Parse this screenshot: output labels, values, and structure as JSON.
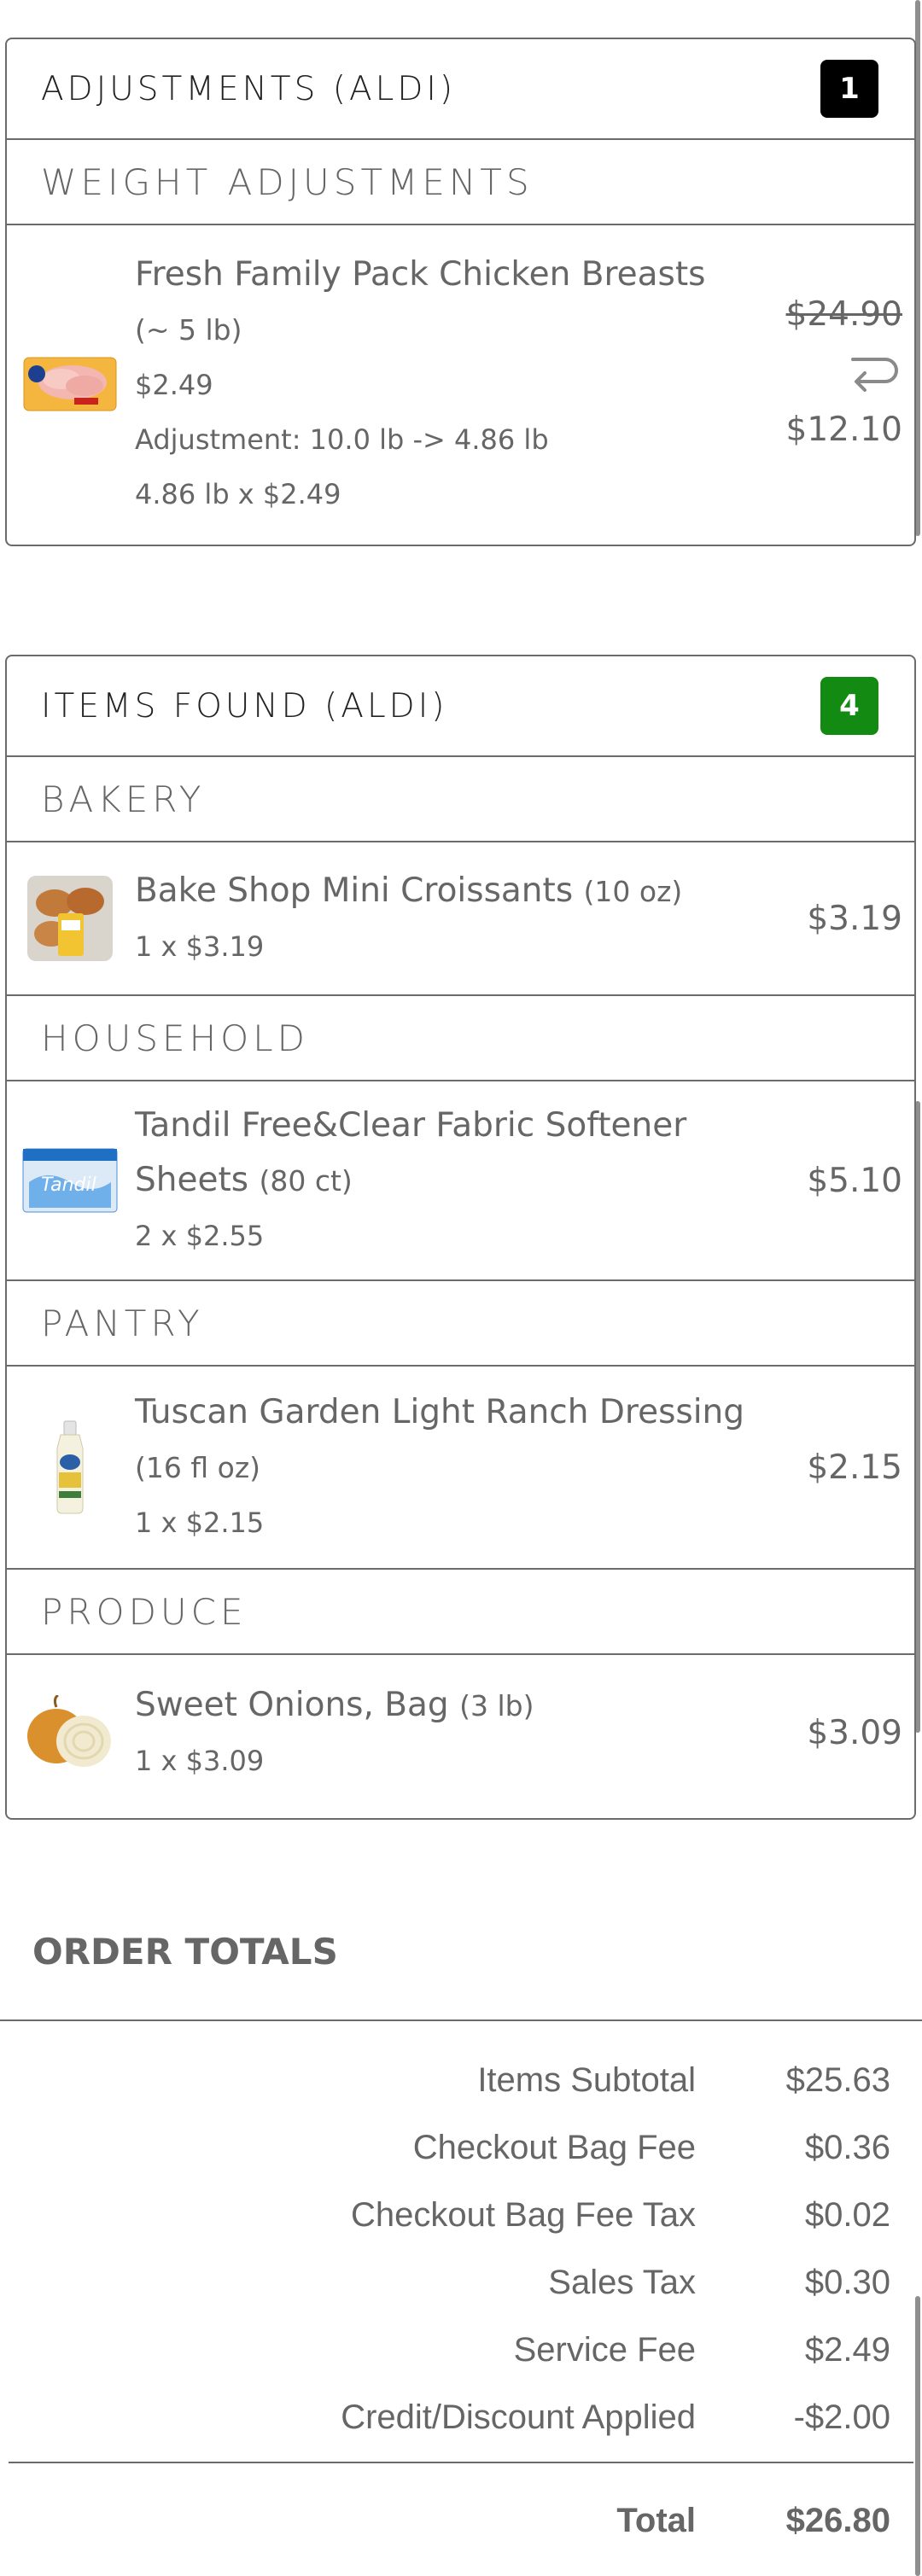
{
  "adjustments_card": {
    "title": "ADJUSTMENTS (ALDI)",
    "count": "1",
    "badge_color": "#000000",
    "section": "WEIGHT ADJUSTMENTS",
    "item": {
      "name": "Fresh Family Pack Chicken Breasts",
      "size": "(~ 5 lb)",
      "unit_price": "$2.49",
      "adjustment": "Adjustment: 10.0 lb -> 4.86 lb",
      "calc": "4.86 lb x $2.49",
      "old_price": "$24.90",
      "new_price": "$12.10",
      "icon": "return-arrow-icon"
    }
  },
  "found_card": {
    "title": "ITEMS FOUND (ALDI)",
    "count": "4",
    "badge_color": "#138a12",
    "sections": [
      {
        "name": "BAKERY",
        "item": {
          "name": "Bake Shop Mini Croissants",
          "size": "(10 oz)",
          "qty": "1 x $3.19",
          "price": "$3.19"
        }
      },
      {
        "name": "HOUSEHOLD",
        "item": {
          "name": "Tandil Free&Clear Fabric Softener Sheets",
          "size": "(80 ct)",
          "qty": "2 x $2.55",
          "price": "$5.10"
        }
      },
      {
        "name": "PANTRY",
        "item": {
          "name": "Tuscan Garden Light Ranch Dressing",
          "size": "(16 fl oz)",
          "qty": "1 x $2.15",
          "price": "$2.15"
        }
      },
      {
        "name": "PRODUCE",
        "item": {
          "name": "Sweet Onions, Bag",
          "size": "(3 lb)",
          "qty": "1 x $3.09",
          "price": "$3.09"
        }
      }
    ]
  },
  "order_totals": {
    "title": "ORDER TOTALS",
    "rows": [
      {
        "label": "Items Subtotal",
        "value": "$25.63"
      },
      {
        "label": "Checkout Bag Fee",
        "value": "$0.36"
      },
      {
        "label": "Checkout Bag Fee Tax",
        "value": "$0.02"
      },
      {
        "label": "Sales Tax",
        "value": "$0.30"
      },
      {
        "label": "Service Fee",
        "value": "$2.49"
      },
      {
        "label": "Credit/Discount Applied",
        "value": "-$2.00"
      }
    ],
    "total_label": "Total",
    "total_value": "$26.80"
  }
}
